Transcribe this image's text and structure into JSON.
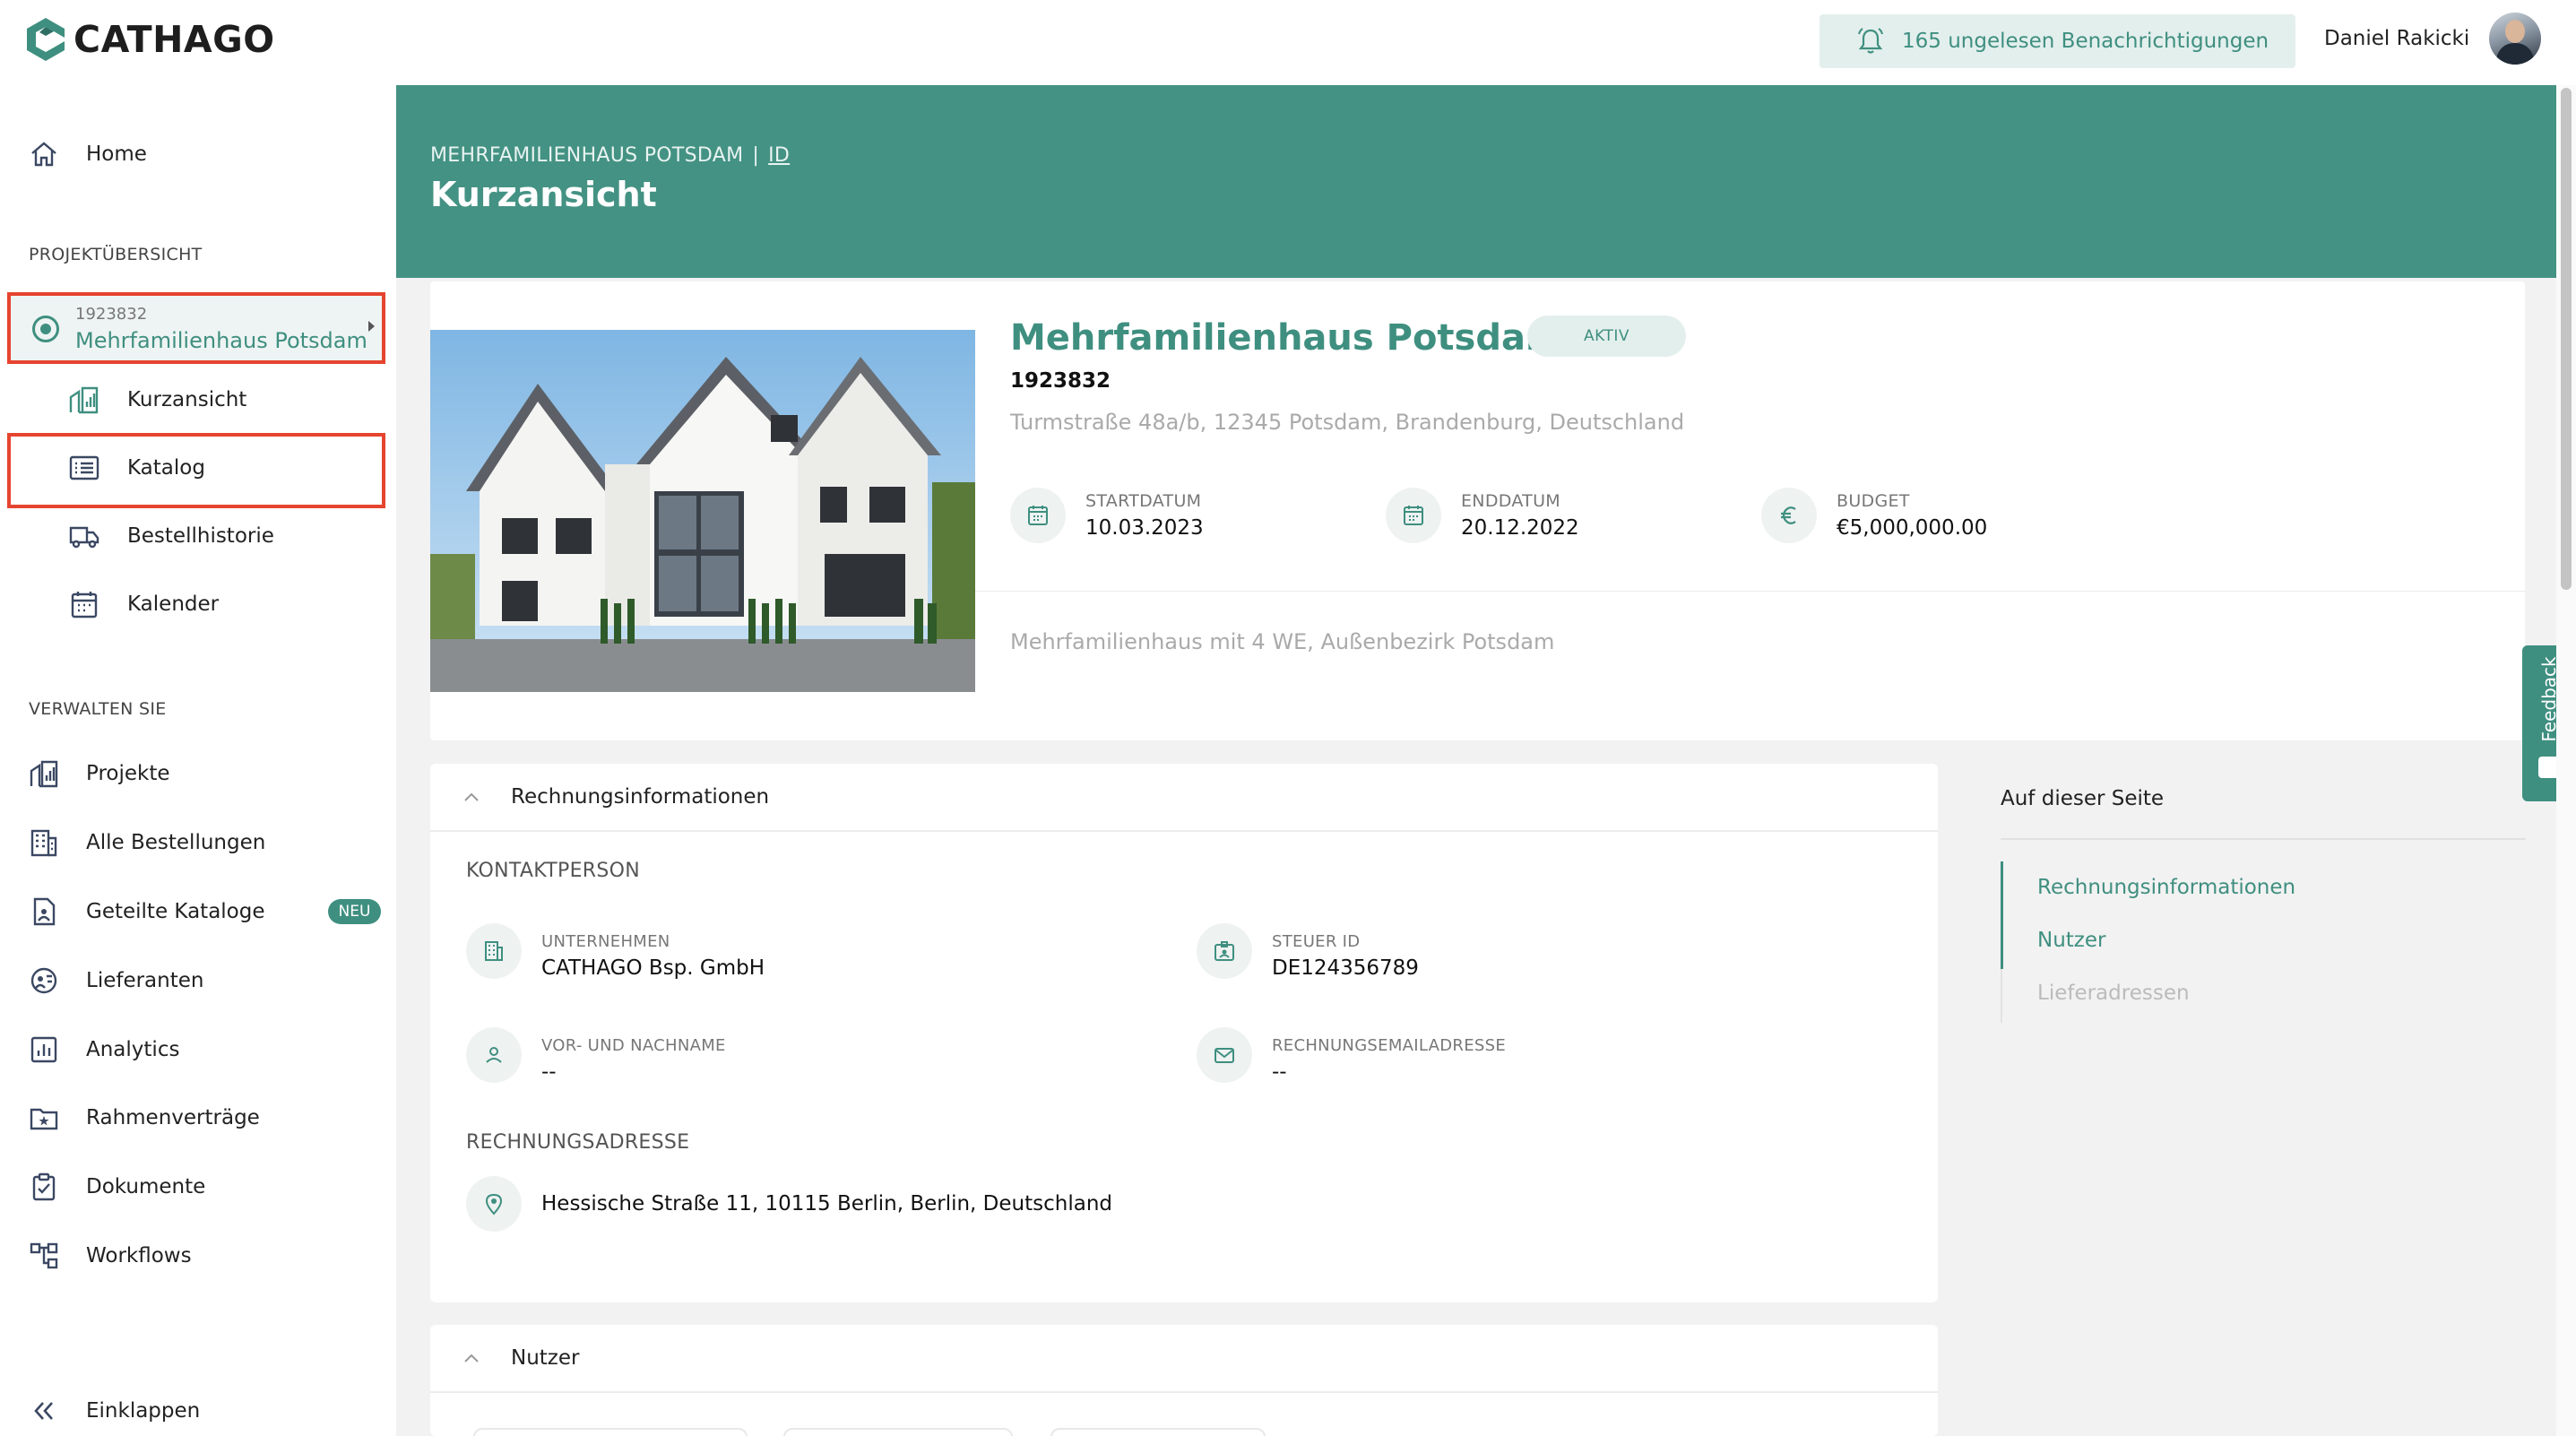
{
  "app": {
    "brand": "CATHAGO",
    "colors": {
      "accent": "#3f8f80",
      "hero": "#449283",
      "highlight": "#e5442f"
    }
  },
  "topbar": {
    "notifications": "165 ungelesen Benachrichtigungen",
    "user_name": "Daniel Rakicki"
  },
  "sidebar": {
    "home": "Home",
    "section_project": "PROJEKTÜBERSICHT",
    "project": {
      "id": "1923832",
      "name": "Mehrfamilienhaus Potsdam"
    },
    "project_items": [
      "Kurzansicht",
      "Katalog",
      "Bestellhistorie",
      "Kalender"
    ],
    "section_manage": "VERWALTEN SIE",
    "manage_items": [
      "Projekte",
      "Alle Bestellungen",
      "Geteilte Kataloge",
      "Lieferanten",
      "Analytics",
      "Rahmenverträge",
      "Dokumente",
      "Workflows"
    ],
    "new_badge": "NEU",
    "collapse": "Einklappen"
  },
  "hero": {
    "breadcrumb_project": "MEHRFAMILIENHAUS POTSDAM",
    "breadcrumb_sep": "|",
    "breadcrumb_id": "ID",
    "title": "Kurzansicht"
  },
  "project_card": {
    "title": "Mehrfamilienhaus Potsdam",
    "status": "AKTIV",
    "id": "1923832",
    "address": "Turmstraße 48a/b, 12345 Potsdam, Brandenburg, Deutschland",
    "start_label": "STARTDATUM",
    "start_value": "10.03.2023",
    "end_label": "ENDDATUM",
    "end_value": "20.12.2022",
    "budget_label": "BUDGET",
    "budget_value": "€5,000,000.00",
    "description": "Mehrfamilienhaus mit 4 WE, Außenbezirk Potsdam"
  },
  "billing": {
    "title": "Rechnungsinformationen",
    "contact_head": "KONTAKTPERSON",
    "company_label": "UNTERNEHMEN",
    "company_value": "CATHAGO Bsp. GmbH",
    "tax_label": "STEUER ID",
    "tax_value": "DE124356789",
    "name_label": "VOR- UND NACHNAME",
    "name_value": "--",
    "email_label": "RECHNUNGSEMAILADRESSE",
    "email_value": "--",
    "address_head": "RECHNUNGSADRESSE",
    "address_value": "Hessische Straße 11, 10115 Berlin, Berlin, Deutschland"
  },
  "users_panel": {
    "title": "Nutzer"
  },
  "on_this_page": {
    "title": "Auf dieser Seite",
    "items": [
      "Rechnungsinformationen",
      "Nutzer",
      "Lieferadressen"
    ]
  },
  "feedback": "Feedback"
}
